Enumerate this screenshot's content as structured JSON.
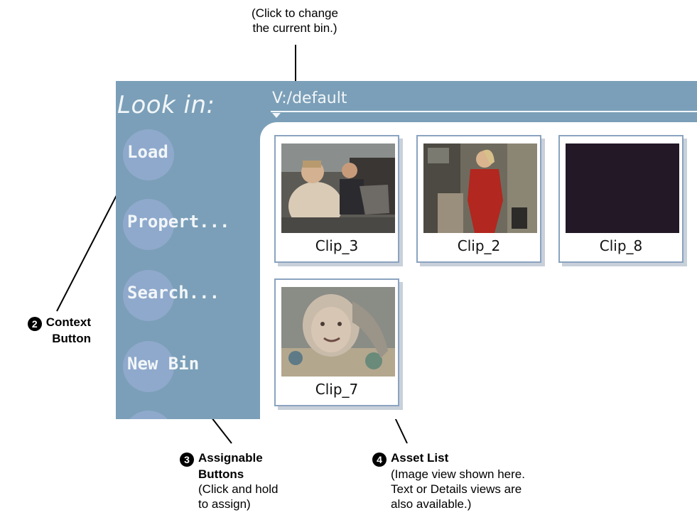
{
  "annotations": {
    "current_bin_note_line1": "(Click to change",
    "current_bin_note_line2": "the current bin.)",
    "context_button": {
      "number": "2",
      "line1": "Context",
      "line2": "Button"
    },
    "assignable_buttons": {
      "number": "3",
      "line1": "Assignable",
      "line2": "Buttons",
      "line3": "(Click and hold",
      "line4": "to assign)"
    },
    "asset_list": {
      "number": "4",
      "title": "Asset List",
      "line2": "(Image view shown here.",
      "line3": "Text or Details views are",
      "line4": "also available.)"
    }
  },
  "panel": {
    "look_in_label": "Look in:",
    "current_bin": "V:/default",
    "buttons": [
      {
        "label": "Load"
      },
      {
        "label": "Propert..."
      },
      {
        "label": "Search..."
      },
      {
        "label": "New Bin"
      },
      {
        "label": ""
      }
    ]
  },
  "assets": [
    {
      "name": "Clip_3",
      "thumbnail": "car-scene"
    },
    {
      "name": "Clip_2",
      "thumbnail": "red-suit-scene"
    },
    {
      "name": "Clip_8",
      "thumbnail": "black-frame"
    },
    {
      "name": "Clip_7",
      "thumbnail": "child-portrait"
    }
  ],
  "colors": {
    "panel_bg": "#7b9fb8",
    "button_disc": "#8fa9cc",
    "tile_border": "#8aa3c0",
    "black_frame": "#221826"
  }
}
